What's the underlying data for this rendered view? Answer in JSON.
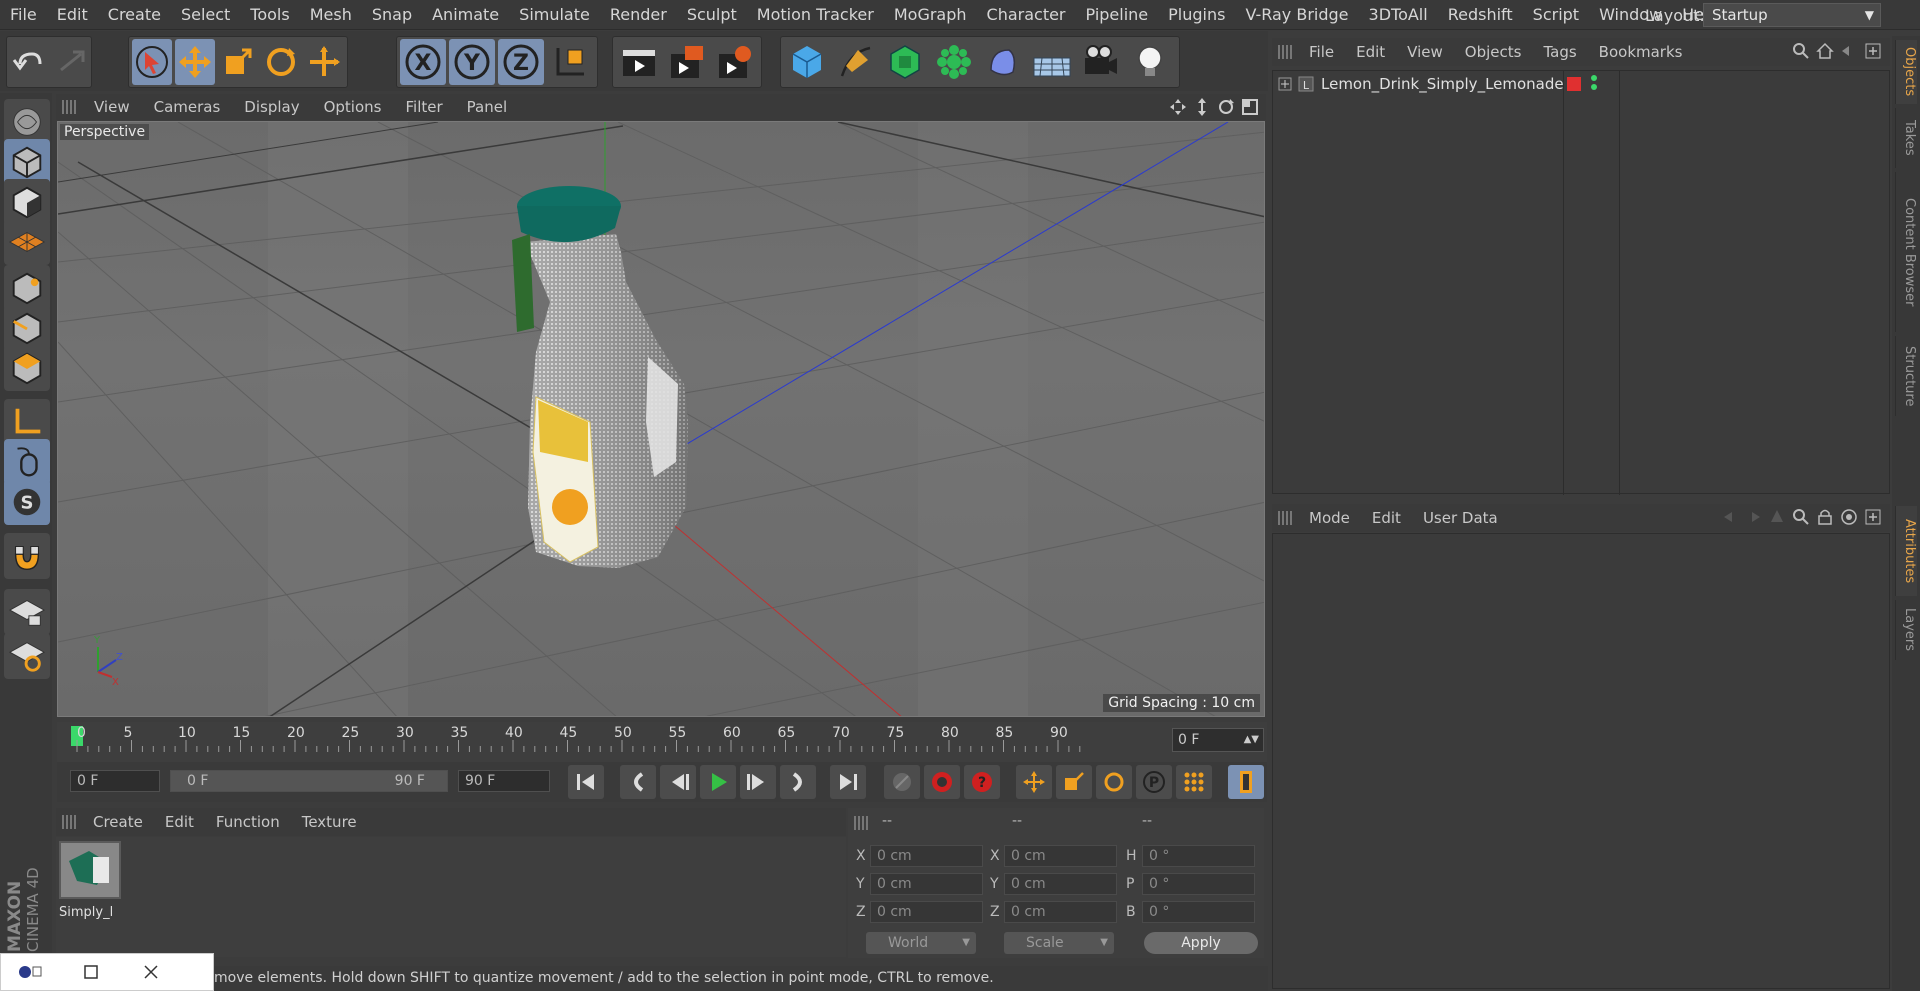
{
  "menubar": {
    "items": [
      "File",
      "Edit",
      "Create",
      "Select",
      "Tools",
      "Mesh",
      "Snap",
      "Animate",
      "Simulate",
      "Render",
      "Sculpt",
      "Motion Tracker",
      "MoGraph",
      "Character",
      "Pipeline",
      "Plugins",
      "V-Ray Bridge",
      "3DToAll",
      "Redshift",
      "Script",
      "Window",
      "Help"
    ],
    "layout_label": "Layout:",
    "layout_value": "Startup"
  },
  "viewport": {
    "menu": [
      "View",
      "Cameras",
      "Display",
      "Options",
      "Filter",
      "Panel"
    ],
    "label": "Perspective",
    "grid_spacing": "Grid Spacing : 10 cm",
    "axis_labels": {
      "y": "Y",
      "z": "Z",
      "x": "X"
    }
  },
  "timeline": {
    "ticks": [
      "0",
      "5",
      "10",
      "15",
      "20",
      "25",
      "30",
      "35",
      "40",
      "45",
      "50",
      "55",
      "60",
      "65",
      "70",
      "75",
      "80",
      "85",
      "90"
    ],
    "current_frame": "0 F",
    "start_field": "0 F",
    "range_start": "0 F",
    "range_end": "90 F",
    "end_field": "90 F"
  },
  "materials": {
    "menu": [
      "Create",
      "Edit",
      "Function",
      "Texture"
    ],
    "items": [
      {
        "label": "Simply_l"
      }
    ]
  },
  "coords": {
    "headers": [
      "--",
      "--",
      "--"
    ],
    "rows": [
      {
        "a_lbl": "X",
        "a": "0 cm",
        "b_lbl": "X",
        "b": "0 cm",
        "c_lbl": "H",
        "c": "0 °"
      },
      {
        "a_lbl": "Y",
        "a": "0 cm",
        "b_lbl": "Y",
        "b": "0 cm",
        "c_lbl": "P",
        "c": "0 °"
      },
      {
        "a_lbl": "Z",
        "a": "0 cm",
        "b_lbl": "Z",
        "b": "0 cm",
        "c_lbl": "B",
        "c": "0 °"
      }
    ],
    "world": "World",
    "scale": "Scale",
    "apply": "Apply"
  },
  "objects": {
    "menu": [
      "File",
      "Edit",
      "View",
      "Objects",
      "Tags",
      "Bookmarks"
    ],
    "items": [
      {
        "name": "Lemon_Drink_Simply_Lemonade",
        "color": "#e03030"
      }
    ]
  },
  "attributes": {
    "menu": [
      "Mode",
      "Edit",
      "User Data"
    ]
  },
  "right_tabs": [
    "Objects",
    "Takes",
    "Content Browser",
    "Structure",
    "Attributes",
    "Layers"
  ],
  "status": "move elements. Hold down SHIFT to quantize movement / add to the selection in point mode, CTRL to remove.",
  "brand": "MAXON CINEMA 4D",
  "colors": {
    "accent": "#e8a64a",
    "active": "#7c92b4",
    "x_axis": "#c03030",
    "y_axis": "#30a030",
    "z_axis": "#3040c0"
  }
}
